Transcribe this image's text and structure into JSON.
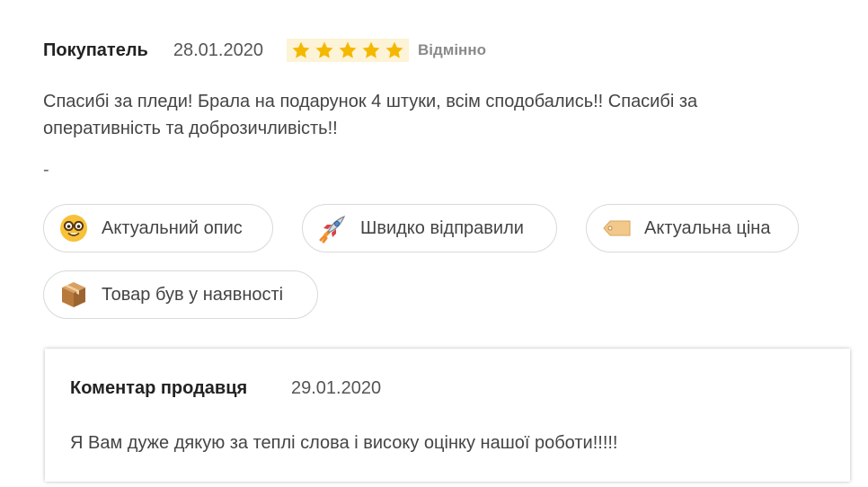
{
  "review": {
    "author": "Покупатель",
    "date": "28.01.2020",
    "rating": 5,
    "rating_max": 5,
    "rating_label": "Відмінно",
    "star_color": "#f5b800",
    "text": "Спасибі за пледи! Брала на подарунок 4 штуки, всім сподобались!! Спасибі за оперативність та доброзичливість!!",
    "dash": "-"
  },
  "tags": [
    {
      "label": "Актуальний опис",
      "icon": "nerd-face-icon"
    },
    {
      "label": "Швидко відправили",
      "icon": "rocket-icon"
    },
    {
      "label": "Актуальна ціна",
      "icon": "price-tag-icon"
    },
    {
      "label": "Товар був у наявності",
      "icon": "package-icon"
    }
  ],
  "seller_reply": {
    "title": "Коментар продавця",
    "date": "29.01.2020",
    "text": "Я Вам дуже дякую за теплі слова і високу оцінку нашої роботи!!!!!"
  }
}
